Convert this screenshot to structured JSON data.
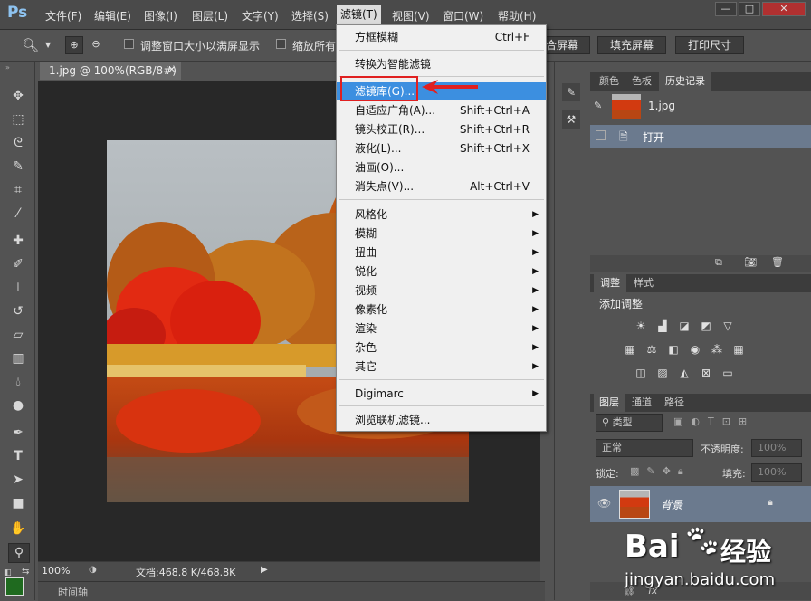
{
  "app": {
    "logo": "Ps"
  },
  "menubar": {
    "items": [
      "文件(F)",
      "编辑(E)",
      "图像(I)",
      "图层(L)",
      "文字(Y)",
      "选择(S)",
      "滤镜(T)",
      "视图(V)",
      "窗口(W)",
      "帮助(H)"
    ],
    "window_controls": [
      "—",
      "□",
      "✕"
    ]
  },
  "options": {
    "chk1_label": "调整窗口大小以满屏显示",
    "chk2_label": "缩放所有",
    "btn_fit": "合屏幕",
    "btn_fill": "填充屏幕",
    "btn_print": "打印尺寸"
  },
  "document": {
    "tab_title": "1.jpg @ 100%(RGB/8#)",
    "zoom": "100%",
    "doc_info": "文档:468.8 K/468.8K",
    "timeline_label": "时间轴"
  },
  "filter_menu": {
    "items": [
      {
        "label": "方框模糊",
        "shortcut": "Ctrl+F"
      },
      {
        "label": "转换为智能滤镜",
        "shortcut": ""
      },
      {
        "label": "滤镜库(G)...",
        "shortcut": ""
      },
      {
        "label": "自适应广角(A)...",
        "shortcut": "Shift+Ctrl+A"
      },
      {
        "label": "镜头校正(R)...",
        "shortcut": "Shift+Ctrl+R"
      },
      {
        "label": "液化(L)...",
        "shortcut": "Shift+Ctrl+X"
      },
      {
        "label": "油画(O)...",
        "shortcut": ""
      },
      {
        "label": "消失点(V)...",
        "shortcut": "Alt+Ctrl+V"
      },
      {
        "label": "风格化",
        "shortcut": ""
      },
      {
        "label": "模糊",
        "shortcut": ""
      },
      {
        "label": "扭曲",
        "shortcut": ""
      },
      {
        "label": "锐化",
        "shortcut": ""
      },
      {
        "label": "视频",
        "shortcut": ""
      },
      {
        "label": "像素化",
        "shortcut": ""
      },
      {
        "label": "渲染",
        "shortcut": ""
      },
      {
        "label": "杂色",
        "shortcut": ""
      },
      {
        "label": "其它",
        "shortcut": ""
      },
      {
        "label": "Digimarc",
        "shortcut": ""
      },
      {
        "label": "浏览联机滤镜...",
        "shortcut": ""
      }
    ]
  },
  "history_panel": {
    "tabs": [
      "颜色",
      "色板",
      "历史记录"
    ],
    "snapshot_name": "1.jpg",
    "state_name": "打开"
  },
  "adjust_panel": {
    "tabs": [
      "调整",
      "样式"
    ],
    "title": "添加调整"
  },
  "layers_panel": {
    "tabs": [
      "图层",
      "通道",
      "路径"
    ],
    "filter_kind": "类型",
    "blend_mode": "正常",
    "opacity_label": "不透明度:",
    "opacity_value": "100%",
    "lock_label": "锁定:",
    "fill_label": "填充:",
    "fill_value": "100%",
    "layer_name": "背景"
  },
  "watermark": {
    "brand": "Bai",
    "brand_cn": "经验",
    "url": "jingyan.baidu.com"
  },
  "colors": {
    "highlight": "#3c8fe0",
    "callout": "#e02020"
  }
}
